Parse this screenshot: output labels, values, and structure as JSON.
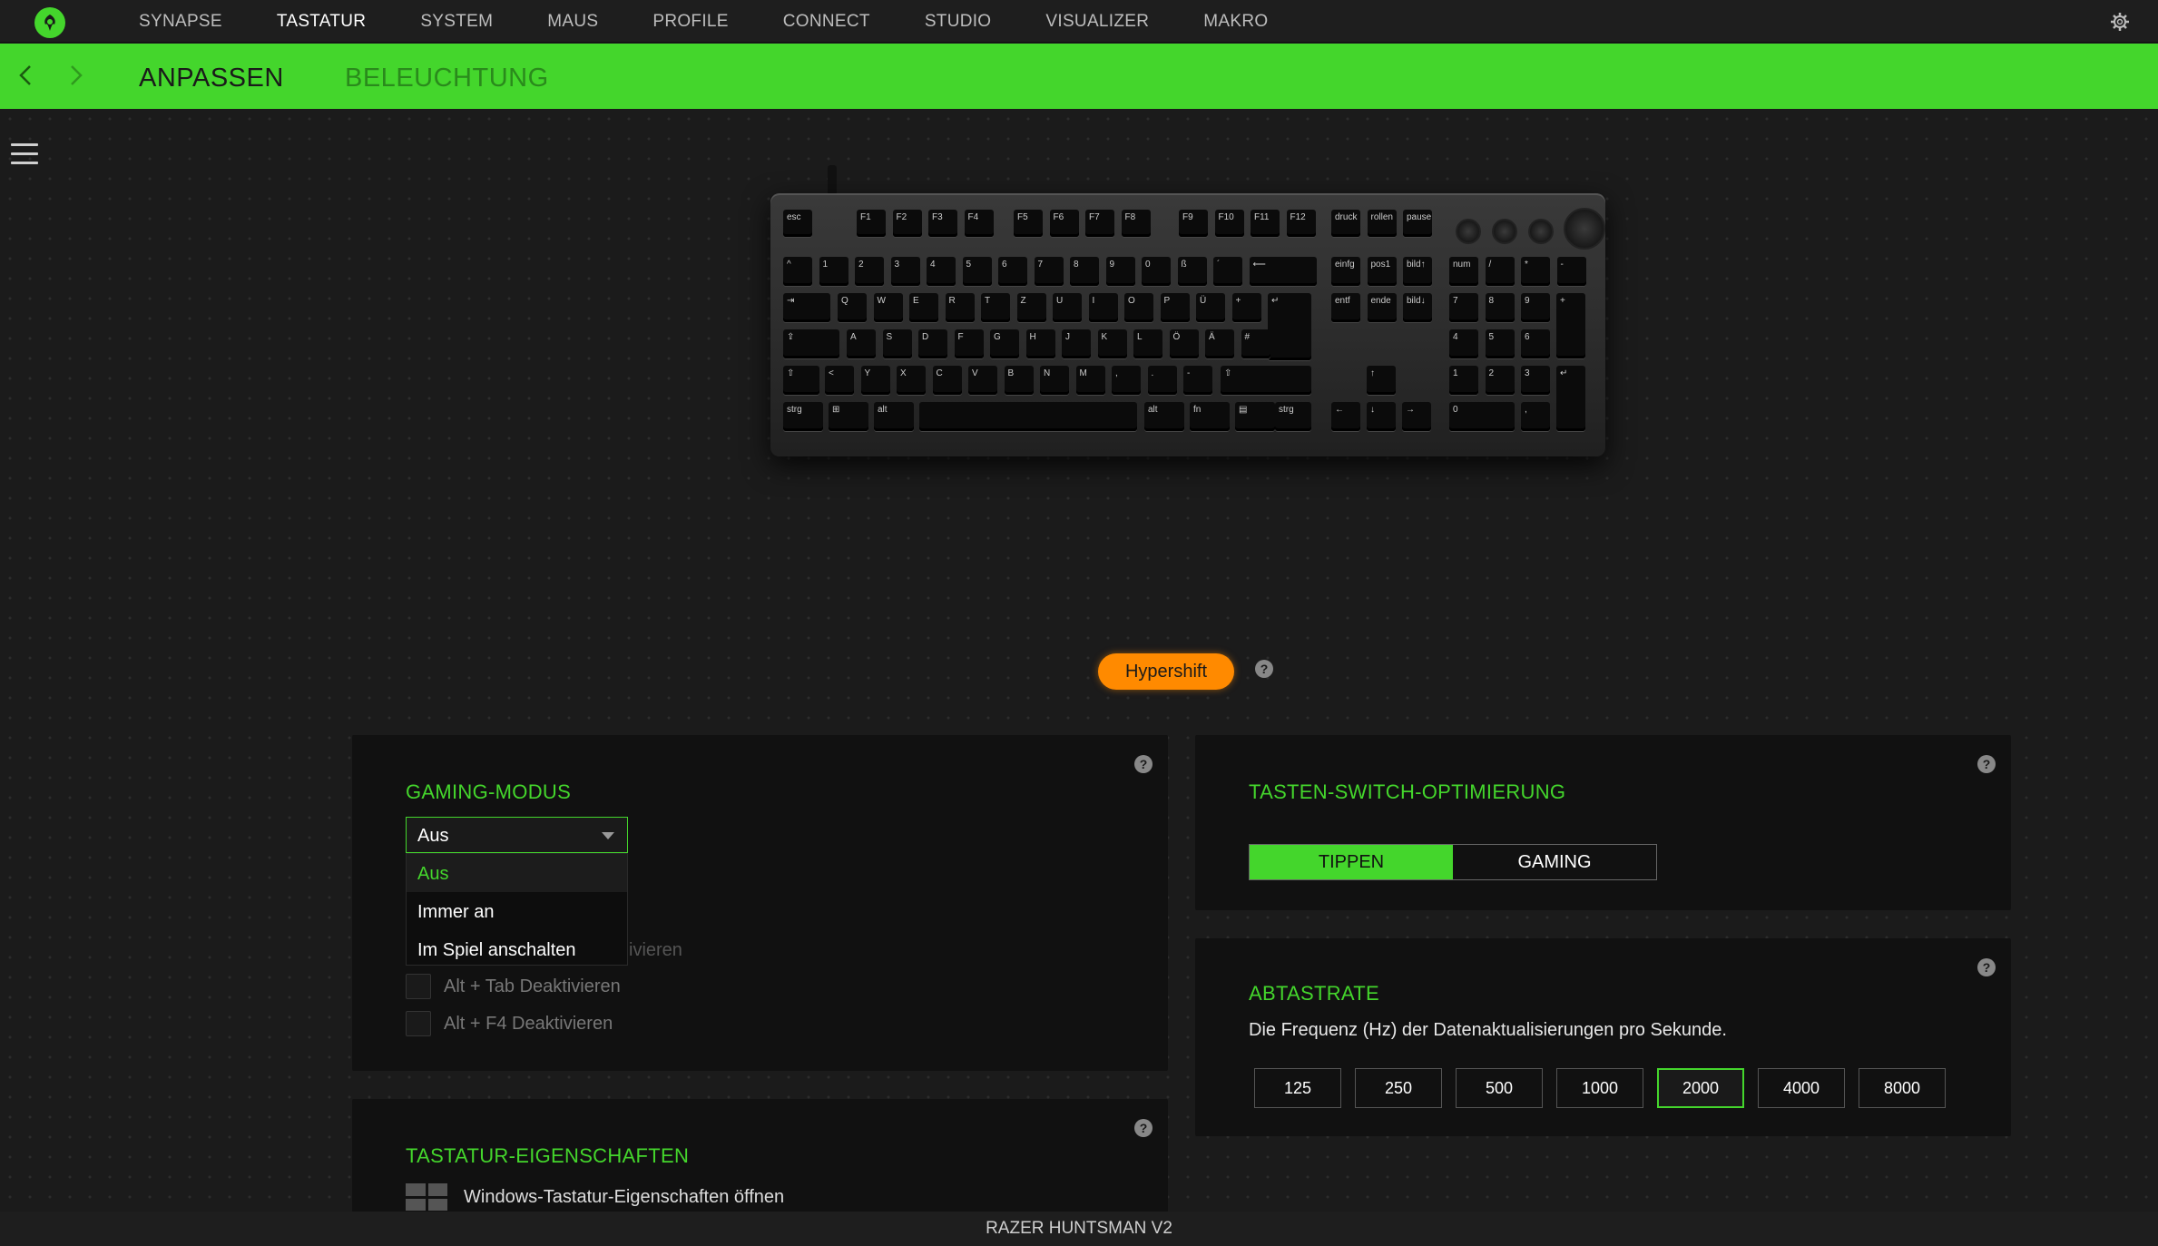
{
  "nav": {
    "items": [
      "SYNAPSE",
      "TASTATUR",
      "SYSTEM",
      "MAUS",
      "PROFILE",
      "CONNECT",
      "STUDIO",
      "VISUALIZER",
      "MAKRO"
    ],
    "active_index": 1
  },
  "subnav": {
    "tabs": [
      "ANPASSEN",
      "BELEUCHTUNG"
    ],
    "active_index": 0
  },
  "keyboard": {
    "hypershift_label": "Hypershift"
  },
  "gaming_mode": {
    "title": "GAMING-MODUS",
    "selected": "Aus",
    "options": [
      "Aus",
      "Immer an",
      "Im Spiel anschalten"
    ],
    "hidden_partial_text": "ivieren",
    "checkboxes": [
      "Alt + Tab Deaktivieren",
      "Alt + F4 Deaktivieren"
    ]
  },
  "keyboard_properties": {
    "title": "TASTATUR-EIGENSCHAFTEN",
    "link_label": "Windows-Tastatur-Eigenschaften öffnen"
  },
  "switch_optimization": {
    "title": "TASTEN-SWITCH-OPTIMIERUNG",
    "options": [
      "TIPPEN",
      "GAMING"
    ],
    "active": "TIPPEN"
  },
  "polling_rate": {
    "title": "ABTASTRATE",
    "description": "Die Frequenz (Hz) der Datenaktualisierungen pro Sekunde.",
    "rates": [
      "125",
      "250",
      "500",
      "1000",
      "2000",
      "4000",
      "8000"
    ],
    "selected": "2000"
  },
  "footer": {
    "device_name": "RAZER HUNTSMAN V2"
  },
  "colors": {
    "accent": "#44d62c",
    "hypershift": "#ff8a00",
    "panel": "#111111",
    "background": "#1b1b1b"
  }
}
